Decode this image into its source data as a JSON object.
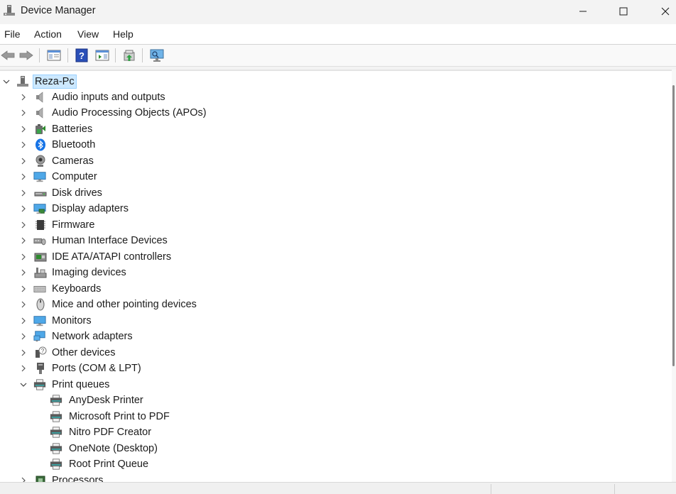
{
  "window": {
    "title": "Device Manager",
    "icon": "device-manager-icon",
    "controls": [
      "minimize-icon",
      "maximize-icon",
      "close-icon"
    ]
  },
  "menu": [
    {
      "label": "File"
    },
    {
      "label": "Action"
    },
    {
      "label": "View"
    },
    {
      "label": "Help"
    }
  ],
  "toolbar": [
    {
      "icon": "back-arrow-icon"
    },
    {
      "icon": "forward-arrow-icon"
    },
    {
      "icon": "show-hide-console-tree-icon"
    },
    {
      "icon": "help-icon"
    },
    {
      "icon": "action-pane-icon"
    },
    {
      "icon": "update-driver-icon"
    },
    {
      "icon": "scan-hardware-icon"
    }
  ],
  "tree": {
    "root": {
      "label": "Reza-Pc",
      "expanded": true,
      "icon": "computer-tower-icon"
    },
    "categories": [
      {
        "label": "Audio inputs and outputs",
        "icon": "speaker-icon",
        "expanded": false
      },
      {
        "label": "Audio Processing Objects (APOs)",
        "icon": "speaker-icon",
        "expanded": false
      },
      {
        "label": "Batteries",
        "icon": "battery-icon",
        "expanded": false
      },
      {
        "label": "Bluetooth",
        "icon": "bluetooth-icon",
        "expanded": false
      },
      {
        "label": "Cameras",
        "icon": "camera-icon",
        "expanded": false
      },
      {
        "label": "Computer",
        "icon": "monitor-icon",
        "expanded": false
      },
      {
        "label": "Disk drives",
        "icon": "disk-drive-icon",
        "expanded": false
      },
      {
        "label": "Display adapters",
        "icon": "display-adapter-icon",
        "expanded": false
      },
      {
        "label": "Firmware",
        "icon": "firmware-chip-icon",
        "expanded": false
      },
      {
        "label": "Human Interface Devices",
        "icon": "hid-icon",
        "expanded": false
      },
      {
        "label": "IDE ATA/ATAPI controllers",
        "icon": "ide-controller-icon",
        "expanded": false
      },
      {
        "label": "Imaging devices",
        "icon": "scanner-icon",
        "expanded": false
      },
      {
        "label": "Keyboards",
        "icon": "keyboard-icon",
        "expanded": false
      },
      {
        "label": "Mice and other pointing devices",
        "icon": "mouse-icon",
        "expanded": false
      },
      {
        "label": "Monitors",
        "icon": "monitor-icon",
        "expanded": false
      },
      {
        "label": "Network adapters",
        "icon": "network-adapter-icon",
        "expanded": false
      },
      {
        "label": "Other devices",
        "icon": "unknown-device-icon",
        "expanded": false
      },
      {
        "label": "Ports (COM & LPT)",
        "icon": "port-icon",
        "expanded": false
      },
      {
        "label": "Print queues",
        "icon": "printer-icon",
        "expanded": true,
        "children": [
          {
            "label": "AnyDesk Printer",
            "icon": "printer-icon"
          },
          {
            "label": "Microsoft Print to PDF",
            "icon": "printer-icon"
          },
          {
            "label": "Nitro PDF Creator",
            "icon": "printer-icon"
          },
          {
            "label": "OneNote (Desktop)",
            "icon": "printer-icon"
          },
          {
            "label": "Root Print Queue",
            "icon": "printer-icon"
          }
        ]
      },
      {
        "label": "Processors",
        "icon": "processor-icon",
        "expanded": false
      }
    ]
  },
  "colors": {
    "selection_bg": "#cce8ff",
    "selection_border": "#99d1ff",
    "text": "#1b1b1b",
    "chrome": "#f3f3f3"
  }
}
